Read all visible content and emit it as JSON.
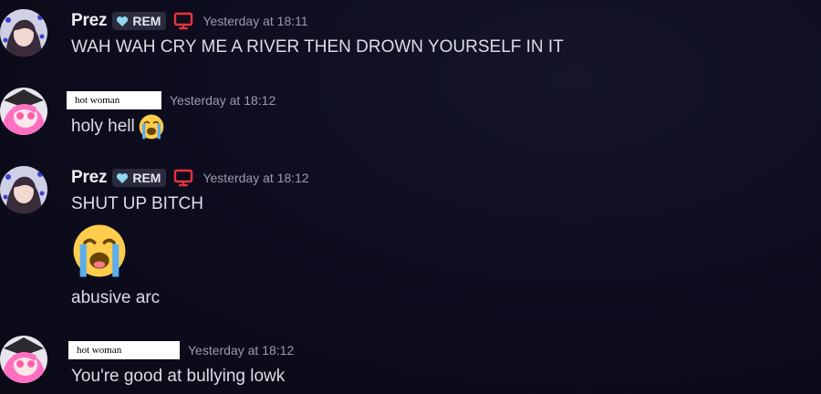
{
  "messages": [
    {
      "author": "Prez",
      "tag": "REM",
      "timestamp": "Yesterday at 18:11",
      "content": "WAH WAH CRY ME A RIVER THEN DROWN YOURSELF IN IT"
    },
    {
      "author": "hot woman",
      "timestamp": "Yesterday at 18:12",
      "content": "holy hell",
      "emoji": "loudly-crying-face"
    },
    {
      "author": "Prez",
      "tag": "REM",
      "timestamp": "Yesterday at 18:12",
      "content": "SHUT UP BITCH",
      "emoji": "loudly-crying-face",
      "followup": "abusive arc"
    },
    {
      "author": "hot woman",
      "timestamp": "Yesterday at 18:12",
      "content": "You're good at bullying lowk"
    }
  ],
  "colors": {
    "background": "#0d0c1d",
    "tag_background": "#2a2b3d",
    "heart": "#8fd8f0",
    "device_icon": "#e8333e",
    "timestamp": "#9a9bad"
  }
}
